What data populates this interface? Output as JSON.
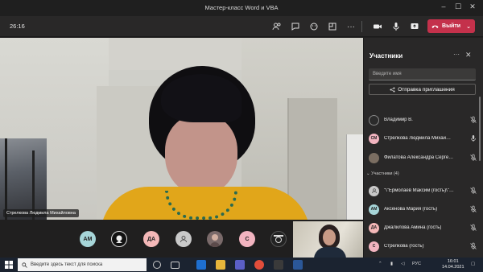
{
  "window": {
    "title": "Мастер-класс Word и VBA"
  },
  "toolbar": {
    "timer": "26:16",
    "leave_label": "Выйти"
  },
  "stage": {
    "speaker_name": "Стрелкова Людмила Михайловна"
  },
  "avatars": [
    {
      "initials": "АМ",
      "color": "#a6d5d8"
    },
    {
      "initials": "",
      "color": "#111111"
    },
    {
      "initials": "ДА",
      "color": "#f4b8b8"
    },
    {
      "initials": "",
      "color": "#c9c9c9"
    },
    {
      "initials": "",
      "color": "#7a6a6a"
    },
    {
      "initials": "С",
      "color": "#f2b4c0"
    },
    {
      "initials": "",
      "color": "#222222"
    }
  ],
  "panel": {
    "title": "Участники",
    "search_placeholder": "Введите имя",
    "invite_label": "Отправка приглашения",
    "section_header": "Участники (4)",
    "presenters": [
      {
        "name": "Владимир В.",
        "initials": "",
        "color": "#2b2b2b"
      },
      {
        "name": "Стрелкова Людмила Михай…",
        "initials": "СМ",
        "color": "#f2b4c0"
      },
      {
        "name": "Филатова Александра Серге…",
        "initials": "",
        "color": "#7b6e62"
      }
    ],
    "attendees": [
      {
        "name": "\"\\\"Ермолаев Максим (гость)\\\"…",
        "initials": "",
        "color": "#c9c9c9"
      },
      {
        "name": "Аксенова Мария (гость)",
        "initials": "АМ",
        "color": "#a6d5d8"
      },
      {
        "name": "Джалилова Амина (гость)",
        "initials": "ДА",
        "color": "#f4b8b8"
      },
      {
        "name": "Стрелкова (гость)",
        "initials": "С",
        "color": "#f2b4c0"
      }
    ]
  },
  "taskbar": {
    "search_placeholder": "Введите здесь текст для поиска",
    "lang": "РУС",
    "time": "16:01",
    "date": "14.04.2021"
  }
}
